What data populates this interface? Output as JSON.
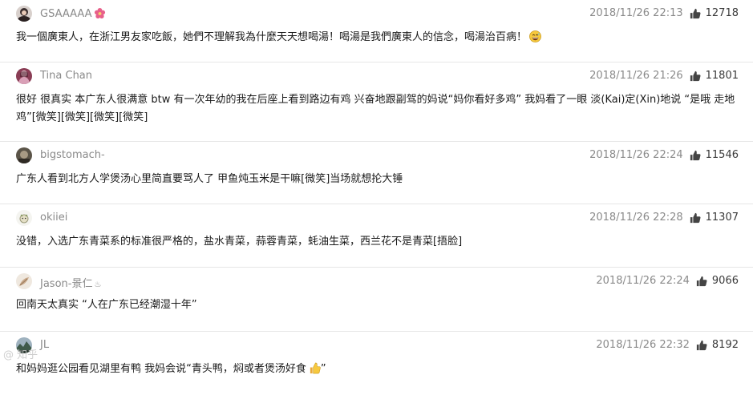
{
  "comments": [
    {
      "username": "GSAAAAA",
      "username_badge": "flower-icon",
      "time": "2018/11/26 22:13",
      "likes": "12718",
      "text": "我一個廣東人，在浙江男友家吃飯，她們不理解我為什麼天天想喝湯！喝湯是我們廣東人的信念，喝湯治百病！",
      "trailing_emoji": "grinning-sweat-emoji"
    },
    {
      "username": "Tina Chan",
      "time": "2018/11/26 21:26",
      "likes": "11801",
      "text": "很好 很真实 本广东人很满意 btw 有一次年幼的我在后座上看到路边有鸡 兴奋地跟副驾的妈说“妈你看好多鸡” 我妈看了一眼 淡(Kai)定(Xin)地说 “是哦 走地鸡”[微笑][微笑][微笑][微笑]"
    },
    {
      "username": "bigstomach-",
      "time": "2018/11/26 22:24",
      "likes": "11546",
      "text": "广东人看到北方人学煲汤心里简直要骂人了 甲鱼炖玉米是干嘛[微笑]当场就想抡大锤"
    },
    {
      "username": "okiiei",
      "time": "2018/11/26 22:28",
      "likes": "11307",
      "text": "没错，入选广东青菜系的标准很严格的，盐水青菜，蒜蓉青菜，蚝油生菜，西兰花不是青菜[捂脸]"
    },
    {
      "username": "Jason-景仁",
      "username_suffix": "♨",
      "time": "2018/11/26 22:24",
      "likes": "9066",
      "text": "回南天太真实 “人在广东已经潮湿十年”"
    },
    {
      "username": "JL",
      "time": "2018/11/26 22:32",
      "likes": "8192",
      "text": "和妈妈逛公园看见湖里有鸭 我妈会说“青头鸭，焖或者煲汤好食",
      "trailing_emoji": "thumbs-up-emoji",
      "text_end": "”"
    }
  ],
  "watermark": "@ 知乎"
}
